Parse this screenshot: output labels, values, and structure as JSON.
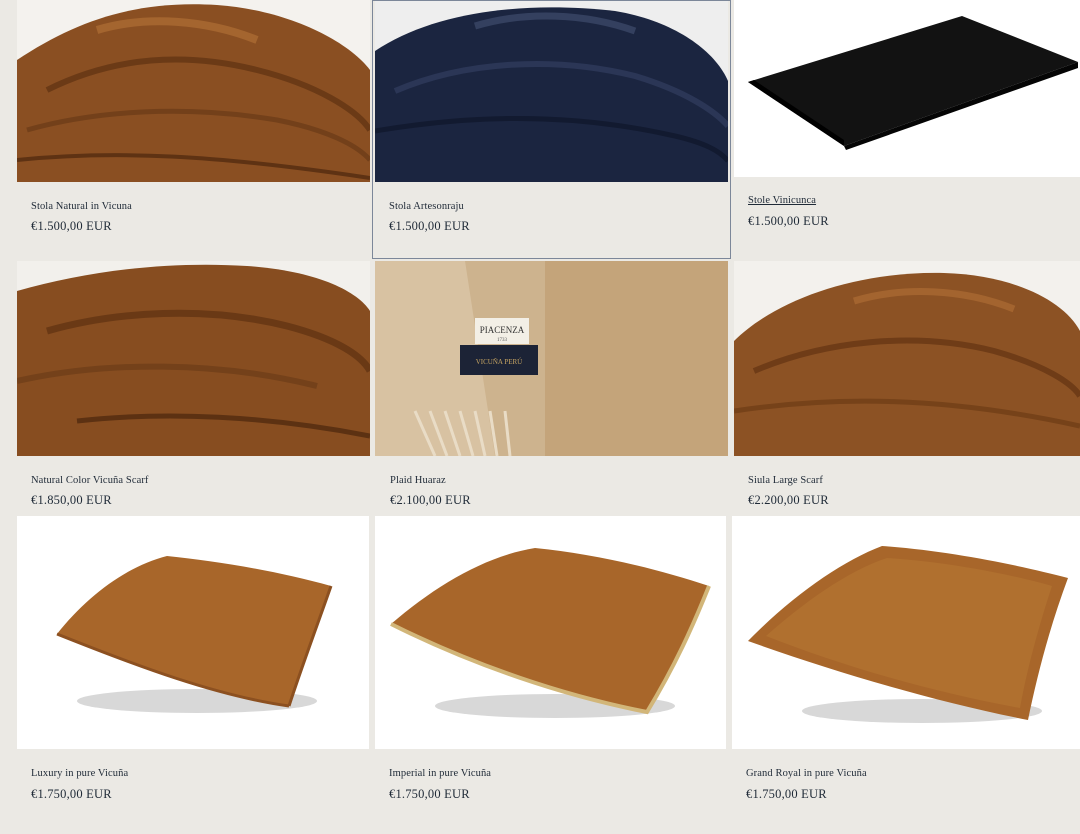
{
  "products": [
    {
      "title": "Stola Natural in Vicuna",
      "price": "€1.500,00 EUR",
      "image": "brown-draped-stole"
    },
    {
      "title": "Stola Artesonraju",
      "price": "€1.500,00 EUR",
      "image": "navy-draped-stole"
    },
    {
      "title": "Stole Vinicunca",
      "price": "€1.500,00 EUR",
      "image": "black-folded-stole"
    },
    {
      "title": "Natural Color Vicuña Scarf",
      "price": "€1.850,00 EUR",
      "image": "brown-draped-scarf"
    },
    {
      "title": "Plaid Huaraz",
      "price": "€2.100,00 EUR",
      "image": "beige-plaid-with-labels",
      "labels": [
        "PIACENZA",
        "1733",
        "VICUÑA PERÚ"
      ]
    },
    {
      "title": "Siula Large Scarf",
      "price": "€2.200,00 EUR",
      "image": "brown-large-scarf"
    },
    {
      "title": "Luxury in pure Vicuña",
      "price": "€1.750,00 EUR",
      "image": "cushion-piped"
    },
    {
      "title": "Imperial in pure Vicuña",
      "price": "€1.750,00 EUR",
      "image": "cushion-gold-cord"
    },
    {
      "title": "Grand Royal in pure Vicuña",
      "price": "€1.750,00 EUR",
      "image": "cushion-flanged"
    }
  ],
  "colors": {
    "background": "#ebe9e4",
    "vicuna_brown": "#8a4f22",
    "navy": "#1b2540",
    "black": "#121212",
    "beige": "#cdb38e",
    "cushion": "#a8662a"
  }
}
